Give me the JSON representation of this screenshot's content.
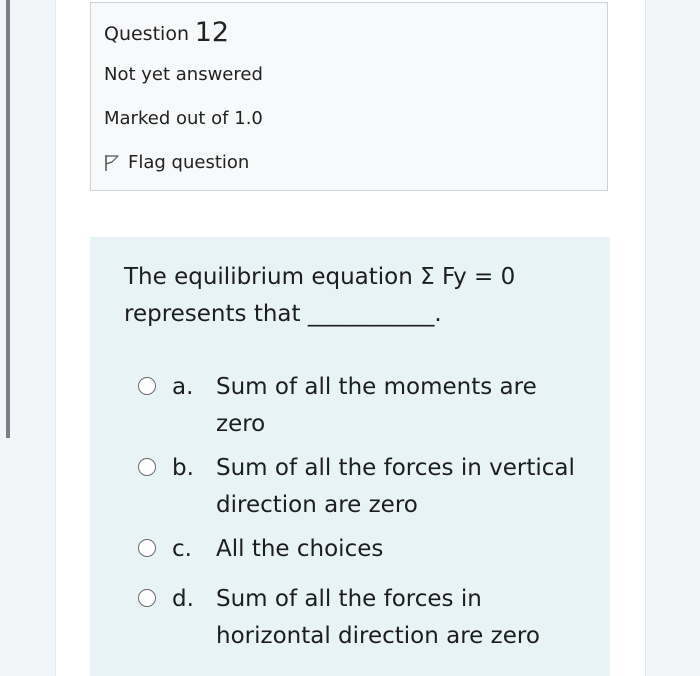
{
  "question_info": {
    "question_word": "Question",
    "question_number": "12",
    "status": "Not yet answered",
    "marks": "Marked out of 1.0",
    "flag_label": "Flag question"
  },
  "question": {
    "text": "The equilibrium equation Σ Fy = 0 represents that ___________."
  },
  "answers": [
    {
      "letter": "a.",
      "text": "Sum of all the moments are zero"
    },
    {
      "letter": "b.",
      "text": "Sum of all the forces in vertical direction are zero"
    },
    {
      "letter": "c.",
      "text": "All the choices"
    },
    {
      "letter": "d.",
      "text": "Sum of all the forces in horizontal direction are zero"
    }
  ],
  "colors": {
    "page_background": "#f3f6f9",
    "content_background": "#e7f3f5",
    "info_background": "#f8f9fa"
  }
}
